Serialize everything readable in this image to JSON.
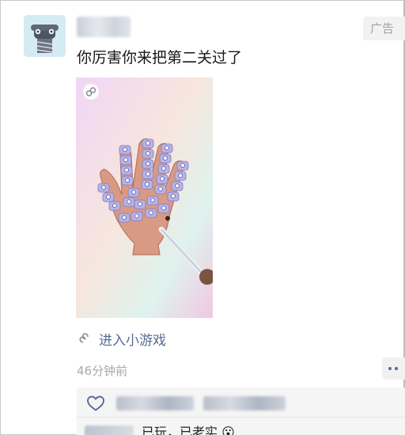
{
  "post": {
    "ad_label": "广告",
    "text": "你厉害你来把第二关过了",
    "enter_game_label": "进入小游戏",
    "time": "46分钟前"
  },
  "comment": {
    "text": "已玩，已老实 😮"
  },
  "icons": {
    "avatar": "screw-avatar-icon",
    "mini_program": "mini-program-link-icon",
    "like": "heart-icon",
    "more": "more-dots-icon"
  },
  "colors": {
    "link": "#576b95",
    "muted": "#a8a8a8",
    "screw": "#b7b3e6"
  }
}
